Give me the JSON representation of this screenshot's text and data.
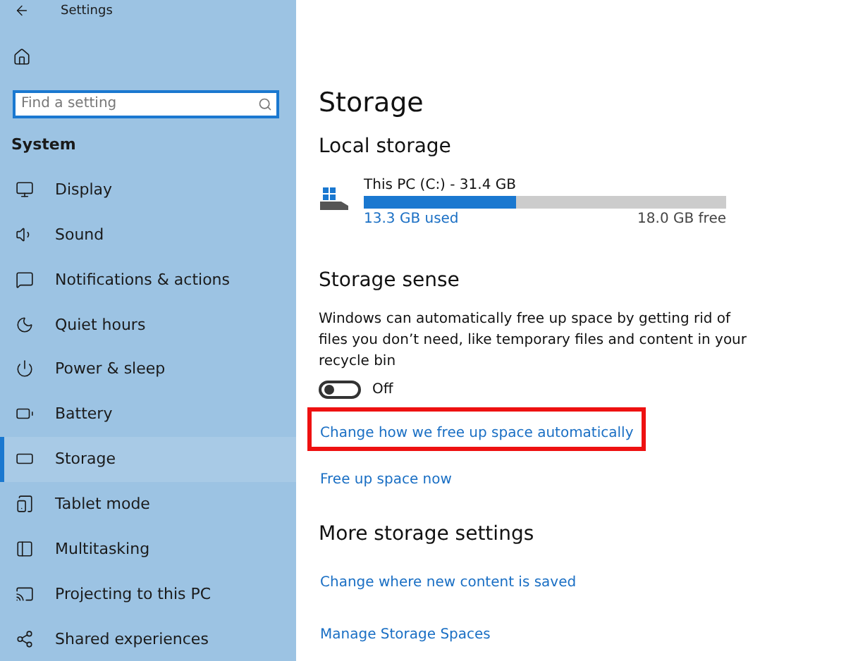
{
  "window": {
    "title": "Settings"
  },
  "search": {
    "placeholder": "Find a setting"
  },
  "sidebar": {
    "section": "System",
    "items": [
      {
        "label": "Display",
        "selected": false
      },
      {
        "label": "Sound",
        "selected": false
      },
      {
        "label": "Notifications & actions",
        "selected": false
      },
      {
        "label": "Quiet hours",
        "selected": false
      },
      {
        "label": "Power & sleep",
        "selected": false
      },
      {
        "label": "Battery",
        "selected": false
      },
      {
        "label": "Storage",
        "selected": true
      },
      {
        "label": "Tablet mode",
        "selected": false
      },
      {
        "label": "Multitasking",
        "selected": false
      },
      {
        "label": "Projecting to this PC",
        "selected": false
      },
      {
        "label": "Shared experiences",
        "selected": false
      }
    ]
  },
  "page": {
    "title": "Storage",
    "local_storage": {
      "heading": "Local storage",
      "drive": {
        "name": "This PC (C:) - 31.4 GB",
        "level": 0.42,
        "used": "13.3 GB used",
        "free": "18.0 GB free"
      }
    },
    "storage_sense": {
      "heading": "Storage sense",
      "description": "Windows can automatically free up space by getting rid of files you don’t need, like temporary files and content in your recycle bin",
      "toggle": {
        "on": false,
        "label": "Off"
      },
      "links": [
        {
          "label": "Change how we free up space automatically",
          "highlighted": true
        },
        {
          "label": "Free up space now",
          "highlighted": false
        }
      ]
    },
    "more": {
      "heading": "More storage settings",
      "links": [
        {
          "label": "Change where new content is saved",
          "highlighted": false
        },
        {
          "label": "Manage Storage Spaces",
          "highlighted": false
        }
      ]
    }
  }
}
